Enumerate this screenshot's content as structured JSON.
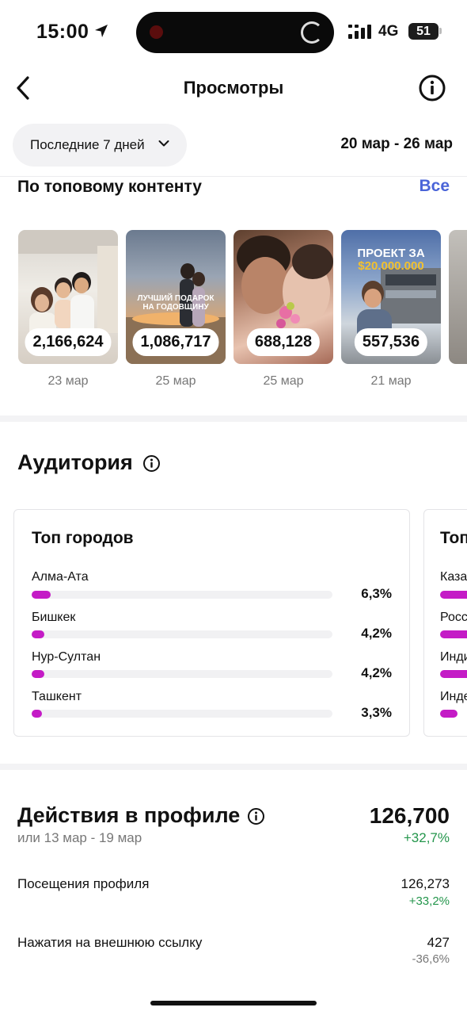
{
  "status_bar": {
    "time": "15:00",
    "network": "4G",
    "battery": "51"
  },
  "header": {
    "title": "Просмотры"
  },
  "filter": {
    "period_label": "Последние 7 дней",
    "date_range": "20 мар - 26 мар"
  },
  "top_content": {
    "title": "По топовому контенту",
    "see_all": "Все",
    "items": [
      {
        "views": "2,166,624",
        "date": "23 мар"
      },
      {
        "views": "1,086,717",
        "date": "25 мар",
        "overlay": "ЛУЧШИЙ ПОДАРОК НА ГОДОВЩИНУ"
      },
      {
        "views": "688,128",
        "date": "25 мар"
      },
      {
        "views": "557,536",
        "date": "21 мар",
        "overlay_top": "ПРОЕКТ ЗА",
        "overlay_amount": "$20.000.000"
      }
    ]
  },
  "audience": {
    "title": "Аудитория",
    "top_cities": {
      "title": "Топ городов",
      "items": [
        {
          "name": "Алма-Ата",
          "percent": "6,3%",
          "value": 6.3
        },
        {
          "name": "Бишкек",
          "percent": "4,2%",
          "value": 4.2
        },
        {
          "name": "Нур-Султан",
          "percent": "4,2%",
          "value": 4.2
        },
        {
          "name": "Ташкент",
          "percent": "3,3%",
          "value": 3.3
        }
      ]
    },
    "top_countries": {
      "title_partial": "Топ",
      "items_partial": [
        "Каза",
        "Росс",
        "Инди",
        "Инде"
      ]
    }
  },
  "profile_actions": {
    "title": "Действия в профиле",
    "comparison": "или 13 мар - 19 мар",
    "total": "126,700",
    "total_change": "+32,7%",
    "rows": [
      {
        "label": "Посещения профиля",
        "value": "126,273",
        "change": "+33,2%"
      },
      {
        "label": "Нажатия на внешнюю ссылку",
        "value": "427",
        "change": "-36,6%"
      }
    ]
  },
  "colors": {
    "accent_link": "#4a64d8",
    "bar_fill": "#c41bc6",
    "positive": "#24964c"
  }
}
